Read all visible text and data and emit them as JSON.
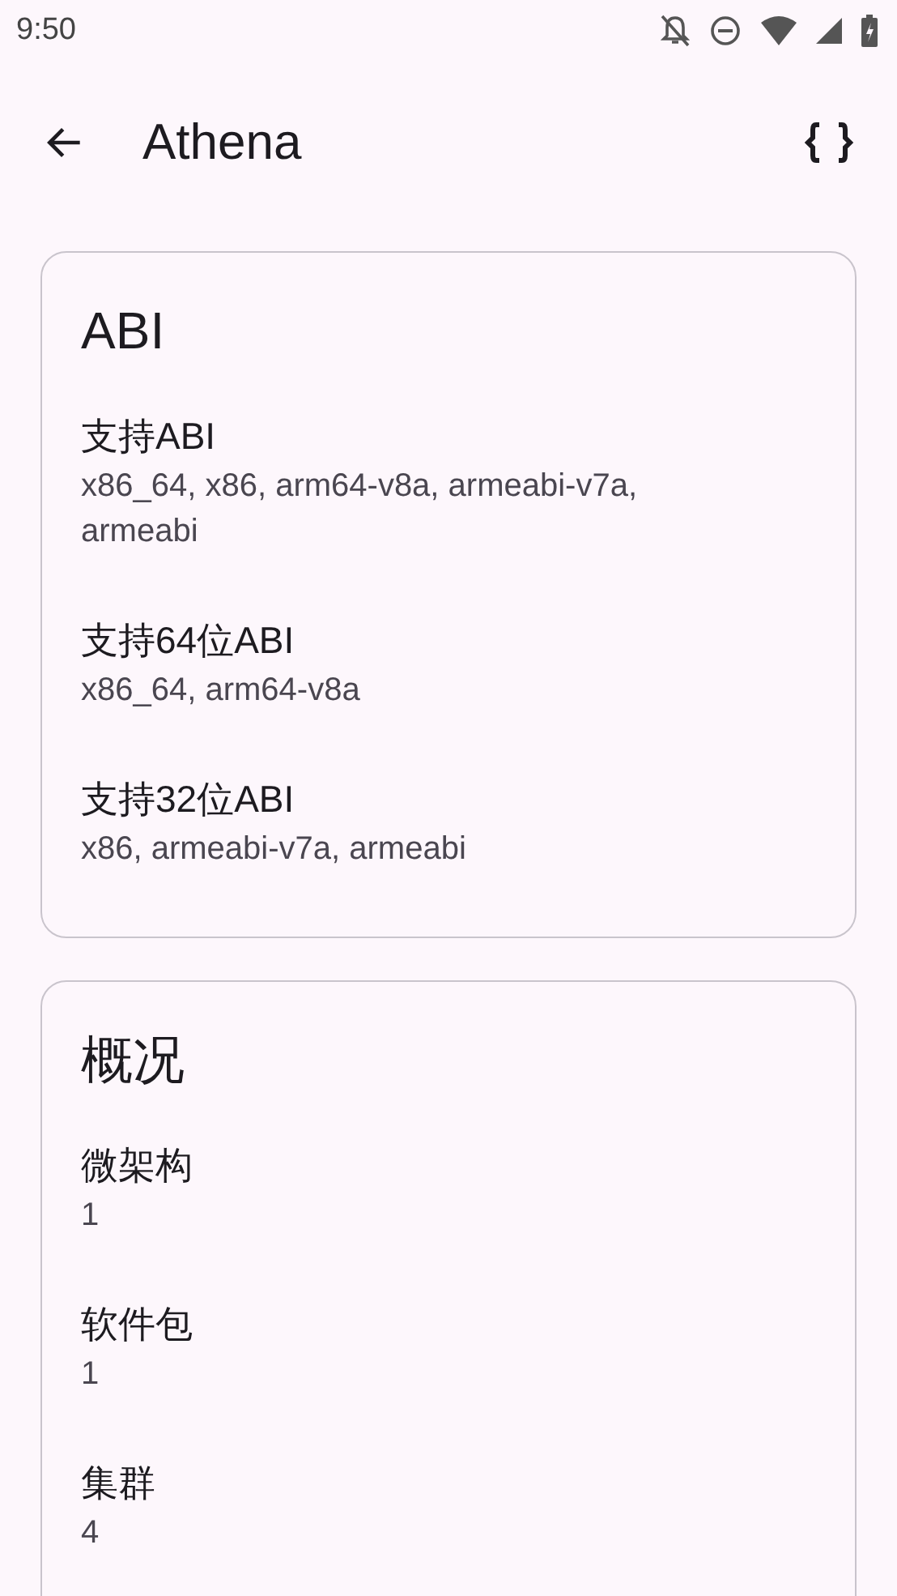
{
  "status_bar": {
    "time": "9:50"
  },
  "toolbar": {
    "title": "Athena"
  },
  "cards": [
    {
      "title": "ABI",
      "items": [
        {
          "label": "支持ABI",
          "value": "x86_64, x86, arm64-v8a, armeabi-v7a, armeabi"
        },
        {
          "label": "支持64位ABI",
          "value": "x86_64, arm64-v8a"
        },
        {
          "label": "支持32位ABI",
          "value": "x86, armeabi-v7a, armeabi"
        }
      ]
    },
    {
      "title": "概况",
      "items": [
        {
          "label": "微架构",
          "value": "1"
        },
        {
          "label": "软件包",
          "value": "1"
        },
        {
          "label": "集群",
          "value": "4"
        }
      ]
    }
  ]
}
